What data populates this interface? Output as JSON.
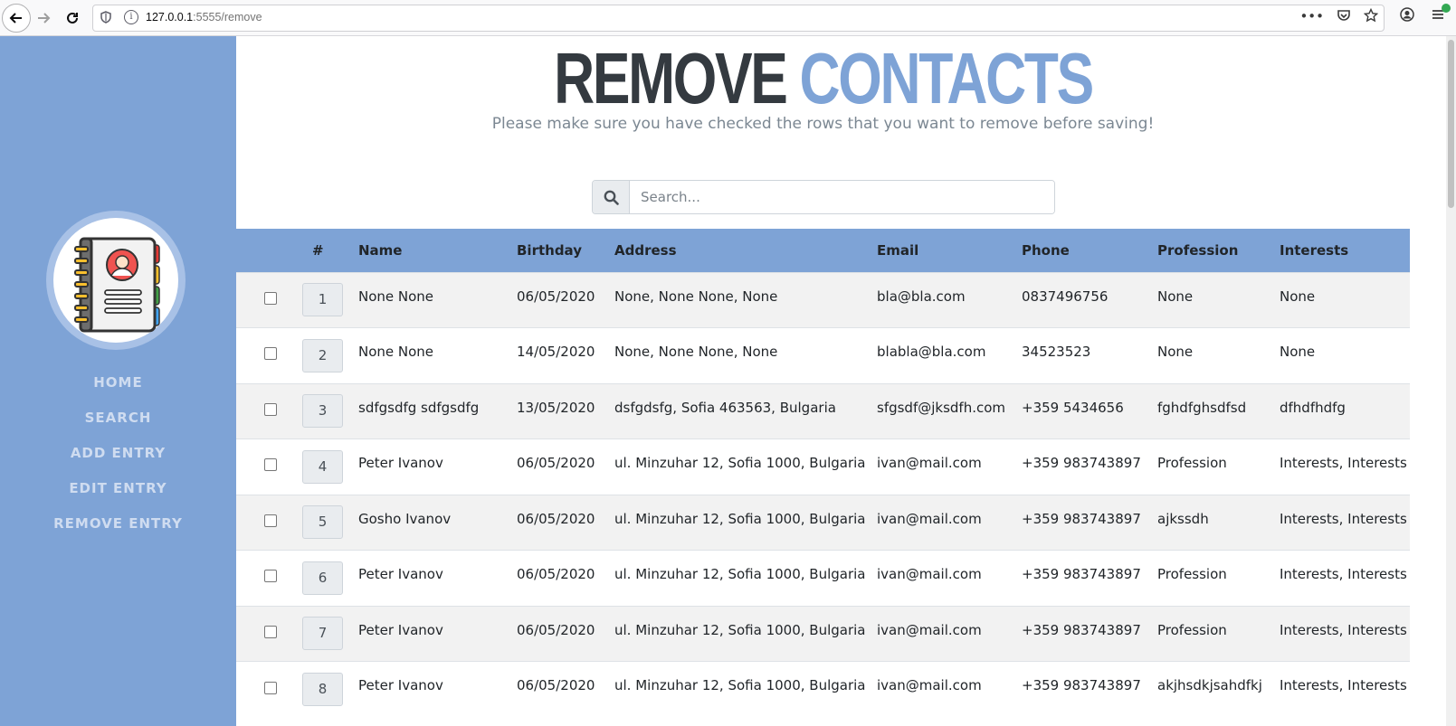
{
  "browser": {
    "url_host": "127.0.0.1",
    "url_path": ":5555/remove"
  },
  "sidebar": {
    "nav": [
      {
        "label": "HOME"
      },
      {
        "label": "SEARCH"
      },
      {
        "label": "ADD ENTRY"
      },
      {
        "label": "EDIT ENTRY"
      },
      {
        "label": "REMOVE ENTRY"
      }
    ],
    "colors": {
      "background": "#7ea3d6",
      "nav_text": "#cfdcf0"
    }
  },
  "header": {
    "title_part1": "REMOVE",
    "title_part2": "CONTACTS",
    "subtitle": "Please make sure you have checked the rows that you want to remove before saving!"
  },
  "search": {
    "placeholder": "Search..."
  },
  "table": {
    "columns": [
      "#",
      "Name",
      "Birthday",
      "Address",
      "Email",
      "Phone",
      "Profession",
      "Interests"
    ],
    "rows": [
      {
        "id": "1",
        "name": "None None",
        "birthday": "06/05/2020",
        "address": "None, None None, None",
        "email": "bla@bla.com",
        "phone": "0837496756",
        "profession": "None",
        "interests": "None"
      },
      {
        "id": "2",
        "name": "None None",
        "birthday": "14/05/2020",
        "address": "None, None None, None",
        "email": "blabla@bla.com",
        "phone": "34523523",
        "profession": "None",
        "interests": "None"
      },
      {
        "id": "3",
        "name": "sdfgsdfg sdfgsdfg",
        "birthday": "13/05/2020",
        "address": "dsfgdsfg, Sofia 463563, Bulgaria",
        "email": "sfgsdf@jksdfh.com",
        "phone": "+359 5434656",
        "profession": "fghdfghsdfsd",
        "interests": "dfhdfhdfg"
      },
      {
        "id": "4",
        "name": "Peter Ivanov",
        "birthday": "06/05/2020",
        "address": "ul. Minzuhar 12, Sofia 1000, Bulgaria",
        "email": "ivan@mail.com",
        "phone": "+359 983743897",
        "profession": "Profession",
        "interests": "Interests, Interests"
      },
      {
        "id": "5",
        "name": "Gosho Ivanov",
        "birthday": "06/05/2020",
        "address": "ul. Minzuhar 12, Sofia 1000, Bulgaria",
        "email": "ivan@mail.com",
        "phone": "+359 983743897",
        "profession": "ajkssdh",
        "interests": "Interests, Interests"
      },
      {
        "id": "6",
        "name": "Peter Ivanov",
        "birthday": "06/05/2020",
        "address": "ul. Minzuhar 12, Sofia 1000, Bulgaria",
        "email": "ivan@mail.com",
        "phone": "+359 983743897",
        "profession": "Profession",
        "interests": "Interests, Interests"
      },
      {
        "id": "7",
        "name": "Peter Ivanov",
        "birthday": "06/05/2020",
        "address": "ul. Minzuhar 12, Sofia 1000, Bulgaria",
        "email": "ivan@mail.com",
        "phone": "+359 983743897",
        "profession": "Profession",
        "interests": "Interests, Interests"
      },
      {
        "id": "8",
        "name": "Peter Ivanov",
        "birthday": "06/05/2020",
        "address": "ul. Minzuhar 12, Sofia 1000, Bulgaria",
        "email": "ivan@mail.com",
        "phone": "+359 983743897",
        "profession": "akjhsdkjsahdfkj",
        "interests": "Interests, Interests"
      }
    ]
  },
  "colors": {
    "accent": "#7ea3d6",
    "title_dark": "#343a40",
    "row_striped": "#f2f2f2"
  }
}
